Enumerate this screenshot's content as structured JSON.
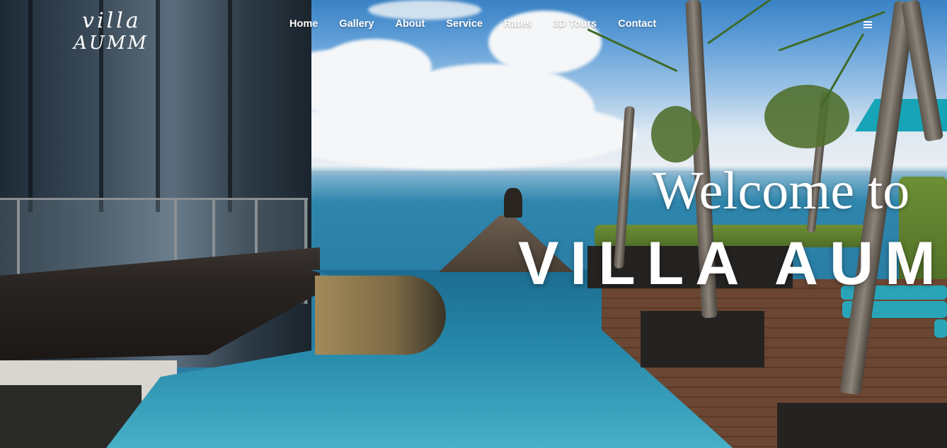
{
  "brand": {
    "logo_line1": "villa",
    "logo_line2": "AUMM"
  },
  "nav": {
    "items": [
      {
        "label": "Home"
      },
      {
        "label": "Gallery"
      },
      {
        "label": "About"
      },
      {
        "label": "Service"
      },
      {
        "label": "Rates"
      },
      {
        "label": "3D Tours"
      },
      {
        "label": "Contact"
      }
    ],
    "menu_icon": "hamburger-menu-icon"
  },
  "hero": {
    "welcome_text": "Welcome to",
    "title_text": "VILLA AUM",
    "background_description_colors": {
      "sky": "#5b9bd6",
      "sea": "#2a7fa6",
      "deck": "#6b4632"
    }
  }
}
